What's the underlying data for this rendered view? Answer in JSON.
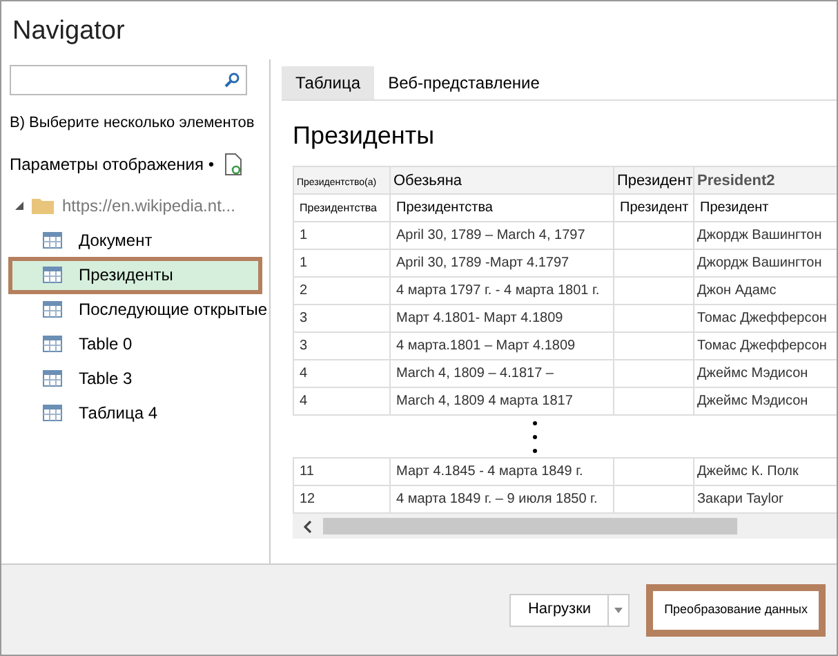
{
  "window": {
    "title": "Navigator"
  },
  "hint": "В) Выберите несколько элементов",
  "display_options": "Параметры отображения •",
  "tree": {
    "label": "https://en.wikipedia.nt...",
    "expanded": true,
    "children": [
      {
        "label": "Документ",
        "selected": false
      },
      {
        "label": "Президенты",
        "selected": true
      },
      {
        "label": "Последующие открытые",
        "selected": false
      },
      {
        "label": "Table 0",
        "selected": false
      },
      {
        "label": "Table 3",
        "selected": false
      },
      {
        "label": "Таблица 4",
        "selected": false
      }
    ]
  },
  "tabs": [
    {
      "label": "Таблица",
      "selected": true
    },
    {
      "label": "Веб-представление",
      "selected": false
    }
  ],
  "preview": {
    "title": "Президенты",
    "columns": [
      "Президентство(а)",
      "Обезьяна",
      "Президент",
      "President2"
    ],
    "subheader": [
      "Президентства",
      "Президентства",
      "Президент",
      "Президент"
    ],
    "rows": [
      {
        "number": "1",
        "dates": "April 30, 1789 – March 4, 1797",
        "president": "Джордж Вашингтон"
      },
      {
        "number": "1",
        "dates": "April 30, 1789 -Март 4.1797",
        "president": "Джордж Вашингтон"
      },
      {
        "number": "2",
        "dates": "4 марта 1797 г. - 4 марта 1801 г.",
        "president": "Джон Адамс"
      },
      {
        "number": "3",
        "dates": "Март 4.1801- Март 4.1809",
        "president": "Томас Джефферсон"
      },
      {
        "number": "3",
        "dates": "4 марта.1801 – Март 4.1809",
        "president": "Томас Джефферсон"
      },
      {
        "number": "4",
        "dates": "March 4, 1809 – 4.1817 –",
        "president": "Джеймс Мэдисон"
      },
      {
        "number": "4",
        "dates": "March 4, 1809 4 марта 1817",
        "president": "Джеймс Мэдисон"
      }
    ],
    "rows_after_gap": [
      {
        "number": "11",
        "dates": "Март 4.1845 - 4 марта 1849 г.",
        "president": "Джеймс К. Полк"
      },
      {
        "number": "12",
        "dates": "4 марта 1849 г. – 9 июля 1850 г.",
        "president": "Закари Taylor"
      }
    ]
  },
  "buttons": {
    "load": "Нагрузки",
    "transform": "Преобразование данных"
  }
}
